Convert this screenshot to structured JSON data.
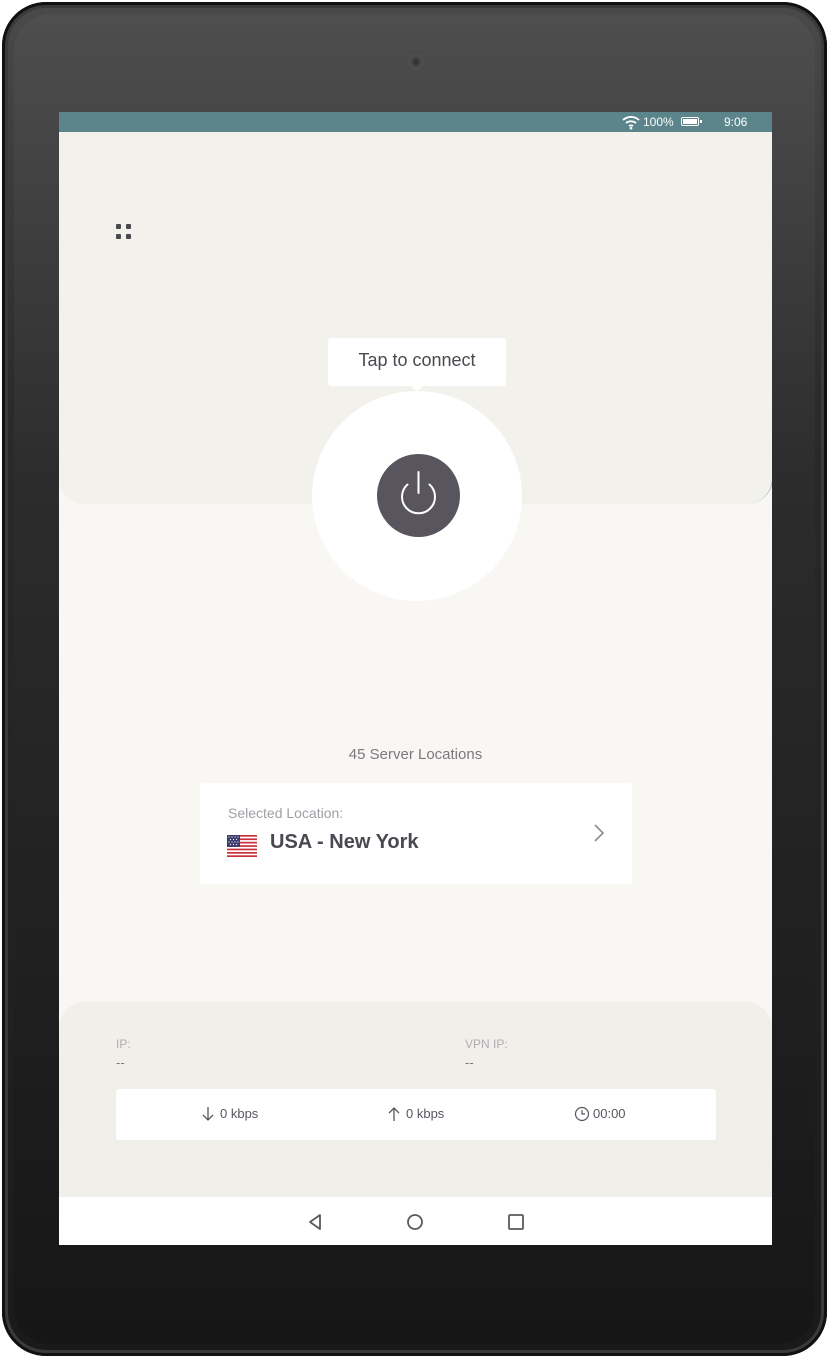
{
  "status_bar": {
    "battery": "100%",
    "time": "9:06",
    "wifi_icon": "wifi-icon",
    "battery_icon": "battery-icon"
  },
  "header": {
    "menu_icon": "grid-dots-icon"
  },
  "connect": {
    "tooltip": "Tap to connect",
    "power_icon": "power-icon"
  },
  "servers": {
    "count_label": "45 Server Locations"
  },
  "location": {
    "label": "Selected Location:",
    "name": "USA - New York",
    "flag_icon": "us-flag-icon",
    "chevron_icon": "chevron-right-icon"
  },
  "connection_info": {
    "ip_label": "IP:",
    "ip_value": "--",
    "vpn_ip_label": "VPN IP:",
    "vpn_ip_value": "--",
    "download": "0 kbps",
    "upload": "0 kbps",
    "duration": "00:00"
  },
  "nav": {
    "back_icon": "back-triangle-icon",
    "home_icon": "home-circle-icon",
    "recents_icon": "recents-square-icon"
  },
  "colors": {
    "status_bar": "#5b858a",
    "power_button": "#58555e",
    "panel": "#f3f1ec",
    "background": "#f8f7f4"
  }
}
